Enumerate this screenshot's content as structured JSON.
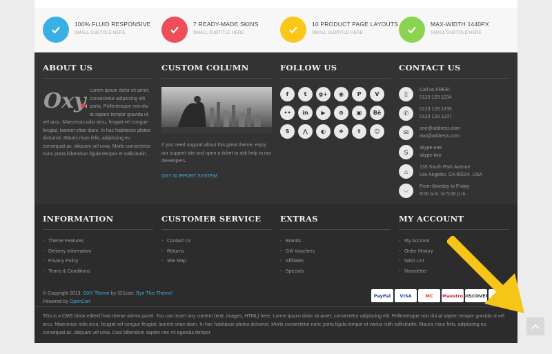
{
  "features": [
    {
      "title": "100% FLUID RESPONSIVE",
      "subtitle": "SMALL SUBTITLE HERE",
      "color": "#3ab0e2"
    },
    {
      "title": "7 READY-MADE SKINS",
      "subtitle": "SMALL SUBTITLE HERE",
      "color": "#ee4e57"
    },
    {
      "title": "10 PRODUCT PAGE LAYOUTS",
      "subtitle": "SMALL SUBTITLE HERE",
      "color": "#fcc617"
    },
    {
      "title": "MAX-WIDTH 1440PX",
      "subtitle": "SMALL SUBTITLE HERE",
      "color": "#8bd452"
    }
  ],
  "about": {
    "title": "ABOUT US",
    "logo_text": "Oxy.",
    "text": "Lorem ipsum dolor sit amet, consectetur adipiscing elit porta. Pellentesque non dui at sapien tempor gravida ut vel arcu. Maecenas odio arcu, feugiat vel congue feugiat, laoreet vitae diam. In hac habitasse platea dictumst. Mauris risus felis, adipiscing eu consequat ac, aliquam vel urna. Morbi consectetur nunc porta bibendum ligula tempor et sollicitudin."
  },
  "custom": {
    "title": "CUSTOM COLUMN",
    "text": "If you need support about this great theme, enjoy our support site and open a ticket to ask help to our developers.",
    "link": "OXY SUPPORT SYSTEM"
  },
  "follow": {
    "title": "FOLLOW US",
    "icons": [
      {
        "name": "facebook-icon",
        "glyph": "f"
      },
      {
        "name": "twitter-icon",
        "glyph": "t"
      },
      {
        "name": "google-plus-icon",
        "glyph": "g+"
      },
      {
        "name": "rss-icon",
        "glyph": "◉"
      },
      {
        "name": "pinterest-icon",
        "glyph": "P"
      },
      {
        "name": "vimeo-icon",
        "glyph": "V"
      },
      {
        "name": "flickr-icon",
        "glyph": "••"
      },
      {
        "name": "linkedin-icon",
        "glyph": "in"
      },
      {
        "name": "youtube-icon",
        "glyph": "▶"
      },
      {
        "name": "dribbble-icon",
        "glyph": "⊛"
      },
      {
        "name": "instagram-icon",
        "glyph": "▣"
      },
      {
        "name": "behance-icon",
        "glyph": "Bē"
      },
      {
        "name": "skype-icon",
        "glyph": "S"
      },
      {
        "name": "vine-icon",
        "glyph": "⋀"
      },
      {
        "name": "delicious-icon",
        "glyph": "◐"
      },
      {
        "name": "foursquare-icon",
        "glyph": "❖"
      },
      {
        "name": "tumblr-icon",
        "glyph": "t"
      },
      {
        "name": "reddit-icon",
        "glyph": "☺"
      }
    ]
  },
  "contact": {
    "title": "CONTACT US",
    "rows": [
      {
        "icon": "mobile-phone-icon",
        "glyph": "▯",
        "lines": [
          "Call us FREE!",
          "0123 123 1234"
        ]
      },
      {
        "icon": "phone-icon",
        "glyph": "✆",
        "lines": [
          "0123 123 1235",
          "0123 123 1237"
        ]
      },
      {
        "icon": "envelope-icon",
        "glyph": "✉",
        "lines": [
          "one@address.com",
          "two@address.com"
        ]
      },
      {
        "icon": "skype-icon",
        "glyph": "S",
        "lines": [
          "skype-one",
          "skype-two"
        ]
      },
      {
        "icon": "home-icon",
        "glyph": "⌂",
        "lines": [
          "135 South Park Avenue",
          "Los Angeles, CA 90024, USA"
        ]
      },
      {
        "icon": "clock-icon",
        "glyph": "⌵",
        "lines": [
          "From Monday to Friday",
          "9:00 a.m. to 5:00 p.m."
        ]
      }
    ]
  },
  "information": {
    "title": "INFORMATION",
    "items": [
      "Theme Features",
      "Delivery Information",
      "Privacy Policy",
      "Terms & Conditions"
    ]
  },
  "customer_service": {
    "title": "CUSTOMER SERVICE",
    "items": [
      "Contact Us",
      "Returns",
      "Site Map"
    ]
  },
  "extras": {
    "title": "EXTRAS",
    "items": [
      "Brands",
      "Gift Vouchers",
      "Affiliates",
      "Specials"
    ]
  },
  "account": {
    "title": "MY ACCOUNT",
    "items": [
      "My Account",
      "Order History",
      "Wish List",
      "Newsletter"
    ]
  },
  "copyright": {
    "prefix": "© Copyright 2013.",
    "theme_link": "OXY Theme",
    "by": "by 321cart.",
    "buy_link": "Bye This Theme!",
    "powered": "Powered by",
    "opencart": "OpenCart"
  },
  "payments": [
    {
      "name": "paypal",
      "label": "PayPal",
      "color": "#1a3d8f"
    },
    {
      "name": "visa",
      "label": "VISA",
      "color": "#1a4fa0"
    },
    {
      "name": "mastercard",
      "label": "MC",
      "color": "#e23a2b"
    },
    {
      "name": "maestro",
      "label": "Maestro",
      "color": "#d0202f"
    },
    {
      "name": "discover",
      "label": "DISCOVER",
      "color": "#333333"
    },
    {
      "name": "other-card",
      "label": "",
      "color": "#999999"
    }
  ],
  "cms": "This is a CMS block edited from theme admin panel. You can insert any content (text, images, HTML) here. Lorem ipsum dolor sit amet, consectetur adipiscing elit. Pellentesque non dui at sapien tempor gravida ut vel arcu. Maecenas odio arcu, feugiat vel congue feugiat, laoreet vitae diam. In hac habitasse platea dictumst. Morbi consectetur nunc porta ligula tempor et varius nibh sollicitudin. Mauris risus felis, adipiscing eu consequat ac, aliquam vel urna. Duis bibendum sapien nec mi egestas tempor.",
  "annotation_color": "#f5c518"
}
